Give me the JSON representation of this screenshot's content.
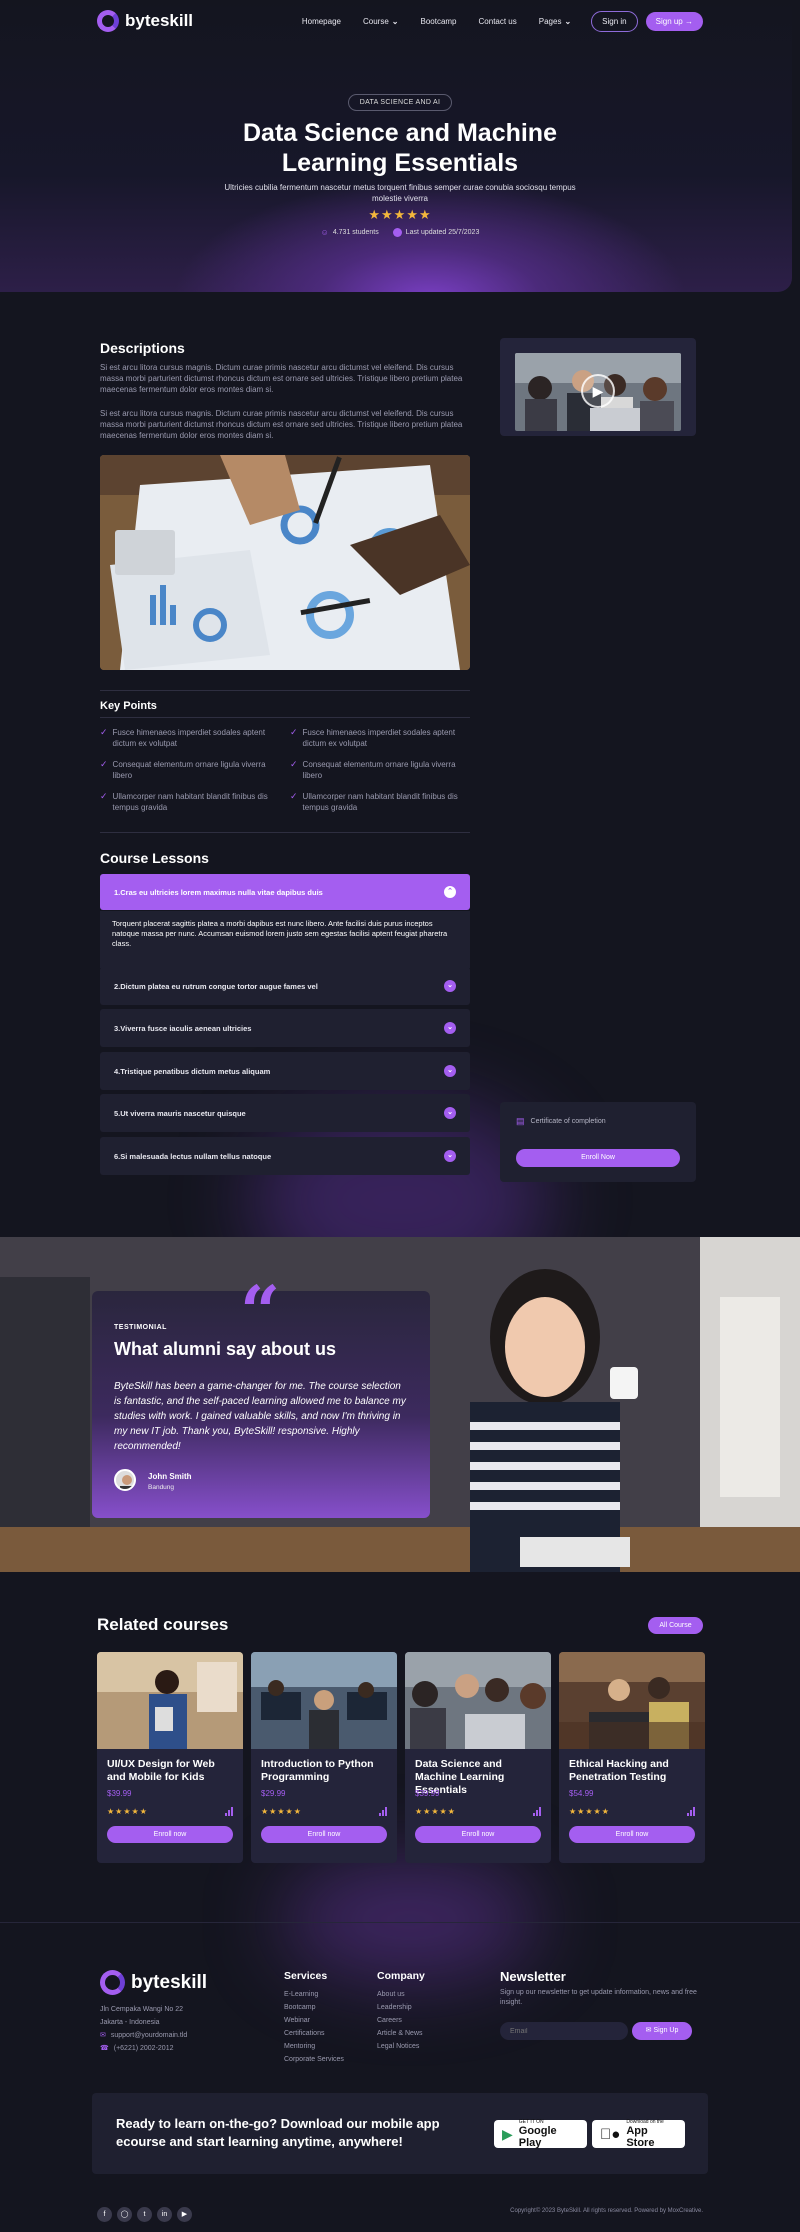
{
  "brand": {
    "name": "byteskill"
  },
  "nav": {
    "links": [
      "Homepage",
      "Course",
      "Bootcamp",
      "Contact us",
      "Pages"
    ],
    "signin": "Sign in",
    "signup": "Sign up"
  },
  "hero": {
    "pill": "DATA SCIENCE AND AI",
    "title": "Data Science and Machine Learning Essentials",
    "subtitle": "Ultricies cubilia fermentum nascetur metus torquent finibus semper curae conubia sociosqu tempus molestie viverra",
    "stars": "★★★★★",
    "students": "4.731 students",
    "updated": "Last updated 25/7/2023"
  },
  "descriptions": {
    "title": "Descriptions",
    "p1": "Si est arcu litora cursus magnis. Dictum curae primis nascetur arcu dictumst vel eleifend. Dis cursus massa morbi parturient dictumst rhoncus dictum est ornare sed ultricies. Tristique libero pretium platea maecenas fermentum dolor eros montes diam si.",
    "p2": "Si est arcu litora cursus magnis. Dictum curae primis nascetur arcu dictumst vel eleifend. Dis cursus massa morbi parturient dictumst rhoncus dictum est ornare sed ultricies. Tristique libero pretium platea maecenas fermentum dolor eros montes diam si."
  },
  "keypoints": {
    "title": "Key Points",
    "items": [
      "Fusce himenaeos imperdiet sodales aptent dictum ex volutpat",
      "Fusce himenaeos imperdiet sodales aptent dictum ex volutpat",
      "Consequat elementum ornare ligula viverra libero",
      "Consequat elementum ornare ligula viverra libero",
      "Ullamcorper nam habitant blandit finibus dis tempus gravida",
      "Ullamcorper nam habitant blandit finibus dis tempus gravida"
    ]
  },
  "lessons": {
    "title": "Course Lessons",
    "items": [
      "1.Cras eu ultricies lorem maximus nulla vitae dapibus duis",
      "2.Dictum platea eu rutrum congue tortor augue fames vel",
      "3.Viverra fusce iaculis aenean ultricies",
      "4.Tristique penatibus dictum metus aliquam",
      "5.Ut viverra mauris nascetur quisque",
      "6.Si malesuada lectus nullam tellus natoque"
    ],
    "open_body": "Torquent placerat sagittis platea a morbi dapibus est nunc libero. Ante facilisi duis purus inceptos natoque massa per nunc. Accumsan euismod lorem justo sem egestas facilisi aptent feugiat pharetra class."
  },
  "sidebar": {
    "certificate": "Certificate of completion",
    "enroll": "Enroll Now"
  },
  "testimonial": {
    "eyebrow": "TESTIMONIAL",
    "title": "What alumni say about us",
    "quote": "ByteSkill has been a game-changer for me. The course selection is fantastic, and the self-paced learning allowed me to balance my studies with work. I gained valuable skills, and now I'm thriving in my new IT job. Thank you, ByteSkill! responsive. Highly recommended!",
    "name": "John Smith",
    "location": "Bandung"
  },
  "related": {
    "title": "Related courses",
    "all": "All Course",
    "courses": [
      {
        "title": "UI/UX Design for Web and Mobile for Kids",
        "price": "$39.99",
        "stars": "★★★★★",
        "enroll": "Enroll now"
      },
      {
        "title": "Introduction to Python Programming",
        "price": "$29.99",
        "stars": "★★★★★",
        "enroll": "Enroll now"
      },
      {
        "title": "Data Science and Machine Learning Essentials",
        "price": "$39.99",
        "stars": "★★★★★",
        "enroll": "Enroll now"
      },
      {
        "title": "Ethical Hacking and Penetration Testing",
        "price": "$54.99",
        "stars": "★★★★★",
        "enroll": "Enroll now"
      }
    ]
  },
  "footer": {
    "address1": "Jln Cempaka Wangi No 22",
    "address2": "Jakarta - Indonesia",
    "email": "support@yourdomain.tld",
    "phone": "(+6221) 2002-2012",
    "services": {
      "title": "Services",
      "items": [
        "E-Learning",
        "Bootcamp",
        "Webinar",
        "Certifications",
        "Mentoring",
        "Corporate Services"
      ]
    },
    "company": {
      "title": "Company",
      "items": [
        "About us",
        "Leadership",
        "Careers",
        "Article & News",
        "Legal Notices"
      ]
    },
    "newsletter": {
      "title": "Newsletter",
      "text": "Sign up our newsletter to get update information, news and free insight.",
      "placeholder": "Email",
      "button": "Sign Up"
    },
    "app": {
      "text": "Ready to learn on-the-go? Download our mobile app ecourse and start learning anytime, anywhere!",
      "gp_small": "GET IT ON",
      "gp_big": "Google Play",
      "as_small": "Download on the",
      "as_big": "App Store"
    },
    "copyright": "Copyright© 2023 ByteSkill. All rights reserved. Powered by MoxCreative."
  }
}
